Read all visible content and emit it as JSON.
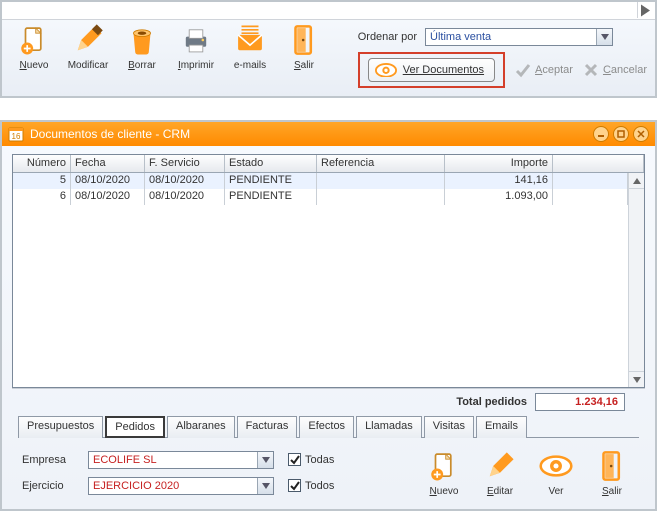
{
  "toolbar": {
    "nuevo": "Nuevo",
    "modificar": "Modificar",
    "borrar": "Borrar",
    "imprimir": "Imprimir",
    "emails": "e-mails",
    "salir": "Salir"
  },
  "order": {
    "label": "Ordenar por",
    "value": "Última venta",
    "ver_documentos": "Ver Documentos",
    "aceptar": "Aceptar",
    "cancelar": "Cancelar"
  },
  "crm": {
    "title": "Documentos de cliente - CRM"
  },
  "grid": {
    "headers": {
      "numero": "Número",
      "fecha": "Fecha",
      "fservicio": "F. Servicio",
      "estado": "Estado",
      "referencia": "Referencia",
      "importe": "Importe"
    },
    "rows": [
      {
        "numero": "5",
        "fecha": "08/10/2020",
        "fservicio": "08/10/2020",
        "estado": "PENDIENTE",
        "referencia": "",
        "importe": "141,16"
      },
      {
        "numero": "6",
        "fecha": "08/10/2020",
        "fservicio": "08/10/2020",
        "estado": "PENDIENTE",
        "referencia": "",
        "importe": "1.093,00"
      }
    ]
  },
  "totals": {
    "label": "Total pedidos",
    "value": "1.234,16"
  },
  "tabs": {
    "presupuestos": "Presupuestos",
    "pedidos": "Pedidos",
    "albaranes": "Albaranes",
    "facturas": "Facturas",
    "efectos": "Efectos",
    "llamadas": "Llamadas",
    "visitas": "Visitas",
    "emails": "Emails"
  },
  "form": {
    "empresa_label": "Empresa",
    "empresa_value": "ECOLIFE SL",
    "empresa_todas": "Todas",
    "ejercicio_label": "Ejercicio",
    "ejercicio_value": "EJERCICIO 2020",
    "ejercicio_todos": "Todos"
  },
  "bottom": {
    "nuevo": "Nuevo",
    "editar": "Editar",
    "ver": "Ver",
    "salir": "Salir"
  }
}
